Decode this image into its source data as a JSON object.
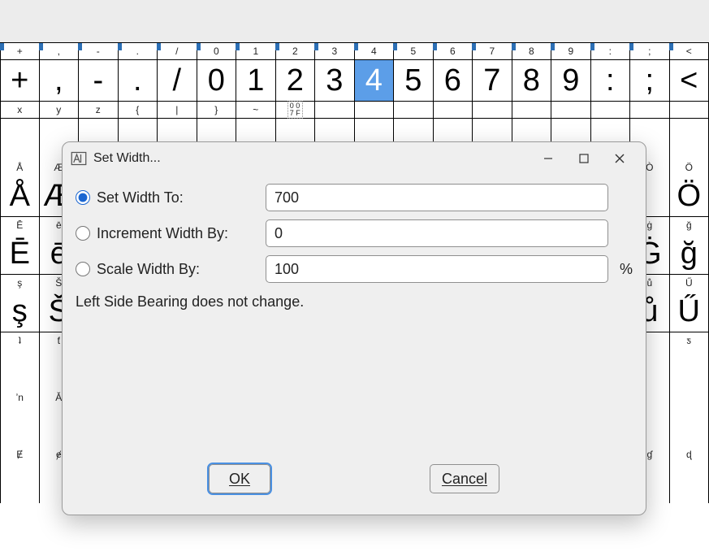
{
  "grid": {
    "row0_labels": [
      "+",
      ",",
      "-",
      ".",
      "/",
      "0",
      "1",
      "2",
      "3",
      "4",
      "5",
      "6",
      "7",
      "8",
      "9",
      ":",
      ";",
      "<"
    ],
    "row0_glyphs": [
      "+",
      ",",
      "-",
      ".",
      "/",
      "0",
      "1",
      "2",
      "3",
      "4",
      "5",
      "6",
      "7",
      "8",
      "9",
      ":",
      ";",
      "<"
    ],
    "selected_col": 9,
    "row1_labels": [
      "x",
      "y",
      "z",
      "{",
      "|",
      "}",
      "~",
      "□"
    ],
    "row2_glyphs_left": [
      "Å",
      "Æ"
    ],
    "row2_glyphs_right": [
      "Ö"
    ],
    "row2_labels_left": [
      "Å",
      "Æ"
    ],
    "row2_labels_right": [
      "Ò",
      "Ö"
    ],
    "row3_labels_left": [
      "Ē",
      "ē"
    ],
    "row3_labels_right": [
      "ġ",
      "ğ"
    ],
    "row3_glyphs_left": [
      "Ē",
      "ē"
    ],
    "row3_glyphs_right": [
      "Ġ",
      "ğ"
    ],
    "row4_labels_left": [
      "ş",
      "Š"
    ],
    "row4_labels_right": [
      "ů",
      "Ű"
    ],
    "row4_glyphs_left": [
      "ş",
      "Š"
    ],
    "row4_glyphs_right": [
      "ů",
      "Ű"
    ],
    "row5_labels_left": [
      "ʇ",
      "ƭ"
    ],
    "row5_labels_right": [
      "",
      "ƽ"
    ],
    "row6_labels_left": [
      "ʼn",
      "Ǎ"
    ],
    "row6_labels_right": [
      "",
      ""
    ],
    "row7_labels_left": [
      "Ɇ",
      "ɇ"
    ],
    "row7_labels_right": [
      "ɠ",
      "ɖ"
    ]
  },
  "dialog": {
    "title": "Set Width...",
    "set_width_label": "Set Width To:",
    "set_width_value": "700",
    "increment_label": "Increment Width By:",
    "increment_value": "0",
    "scale_label": "Scale Width By:",
    "scale_value": "100",
    "percent": "%",
    "note": "Left Side Bearing does not change.",
    "ok": "OK",
    "cancel": "Cancel"
  }
}
